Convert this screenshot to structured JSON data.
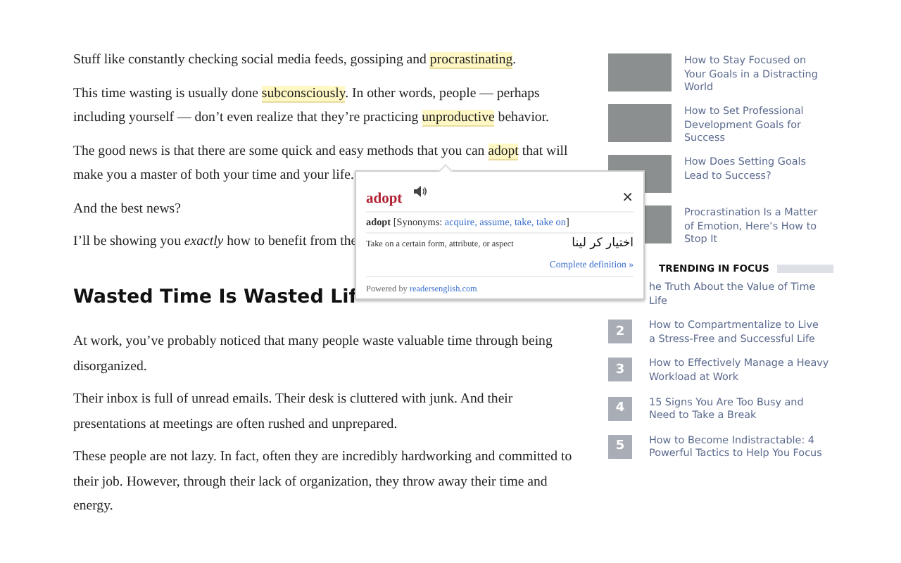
{
  "article": {
    "paragraphs_top": [
      {
        "lines": [
          {
            "segments": [
              {
                "text": "Stuff like constantly checking social media feeds, gossiping and ",
                "highlighted": false
              },
              {
                "text": "procrastinating",
                "highlighted": true
              },
              {
                "text": ".",
                "highlighted": false
              }
            ]
          }
        ]
      },
      {
        "lines": [
          {
            "segments": [
              {
                "text": "This time wasting is usually done ",
                "highlighted": false
              },
              {
                "text": "subconsciously",
                "highlighted": true
              },
              {
                "text": ". In other words, people — perhaps",
                "highlighted": false
              }
            ]
          },
          {
            "segments": [
              {
                "text": "including yourself — don’t even realize that they’re practicing ",
                "highlighted": false
              },
              {
                "text": "unproductive",
                "highlighted": true
              },
              {
                "text": " behavior.",
                "highlighted": false
              }
            ]
          }
        ]
      },
      {
        "lines": [
          {
            "segments": [
              {
                "text": "The good news is that there are some quick and easy methods that you can ",
                "highlighted": false
              },
              {
                "text": "adopt",
                "highlighted": true
              },
              {
                "text": " that will",
                "highlighted": false
              }
            ]
          },
          {
            "segments": [
              {
                "text": "make you a master of both your time and your life.",
                "highlighted": false
              }
            ]
          }
        ]
      },
      {
        "lines": [
          {
            "segments": [
              {
                "text": "And the best news?",
                "highlighted": false
              }
            ]
          }
        ]
      },
      {
        "lines": [
          {
            "segments": [
              {
                "text": "I’ll be showing you *exactly* how to benefit from the",
                "highlighted": false
              }
            ]
          }
        ]
      }
    ],
    "heading": "Wasted Time Is Wasted Lif",
    "paragraphs_bottom": [
      {
        "text": "At work, you’ve probably noticed that many people waste valuable time through being disorganized."
      },
      {
        "text": "Their inbox is full of unread emails. Their desk is cluttered with junk. And their presentations at meetings are often rushed and unprepared."
      },
      {
        "text": "These people are not lazy. In fact, often they are incredibly hardworking and committed to their job. However, through their lack of organization, they throw away their time and energy."
      }
    ]
  },
  "sidebar": {
    "related": [
      {
        "title": "How to Stay Focused on Your Goals in a Distracting World"
      },
      {
        "title": "How to Set Professional Development Goals for Success"
      },
      {
        "title": "How Does Setting Goals Lead to Success?"
      },
      {
        "title": "Procrastination Is a Matter of Emotion, Here’s How to Stop It"
      }
    ],
    "trending_heading": "TRENDING IN FOCUS",
    "trending": [
      {
        "lines": [
          "he Truth About the Value of Time",
          "Life"
        ]
      },
      {
        "number": "2",
        "lines": [
          "How to Compartmentalize to Live",
          "a Stress-Free and Successful Life"
        ]
      },
      {
        "number": "3",
        "lines": [
          "How to Effectively Manage a Heavy",
          "Workload at Work"
        ]
      },
      {
        "number": "4",
        "lines": [
          "15 Signs You Are Too Busy and",
          "Need to Take a Break"
        ]
      },
      {
        "number": "5",
        "lines": [
          "How to Become Indistractable: 4",
          "Powerful Tactics to Help You Focus"
        ]
      }
    ]
  },
  "popup": {
    "word": "adopt",
    "close": "×",
    "headword": "adopt",
    "synonyms_label": "[Synonyms:",
    "synonyms": [
      "acquire",
      "assume",
      "take",
      "take on"
    ],
    "separator": ",",
    "synonyms_end": "]",
    "definition": "Take on a certain form, attribute, or aspect",
    "translation": "اختیار کر لینا",
    "more_link": "Complete definition »",
    "powered_label": "Powered by",
    "powered_link": "readersenglish.com"
  }
}
